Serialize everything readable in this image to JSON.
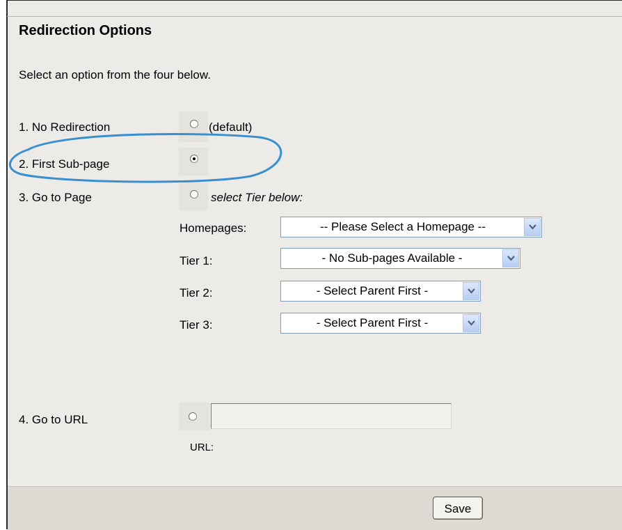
{
  "section_title": "Redirection Options",
  "intro": "Select an option from the four below.",
  "options": [
    {
      "label": "1. No Redirection",
      "radio_text": "(default)",
      "selected": false
    },
    {
      "label": "2. First Sub-page",
      "radio_text": "",
      "selected": true
    },
    {
      "label": "3. Go to Page",
      "radio_text": "select Tier below:",
      "selected": false
    },
    {
      "label": "4. Go to URL",
      "radio_text": "",
      "selected": false
    }
  ],
  "tiers": [
    {
      "label": "Homepages:",
      "value": "-- Please Select a Homepage --"
    },
    {
      "label": "Tier 1:",
      "value": "- No Sub-pages Available -"
    },
    {
      "label": "Tier 2:",
      "value": "- Select Parent First -"
    },
    {
      "label": "Tier 3:",
      "value": "- Select Parent First -"
    }
  ],
  "url": {
    "label": "URL:",
    "value": ""
  },
  "save_label": "Save",
  "highlight_color": "#3a8fd0",
  "dropdown_arrow_color": "#4d6185"
}
